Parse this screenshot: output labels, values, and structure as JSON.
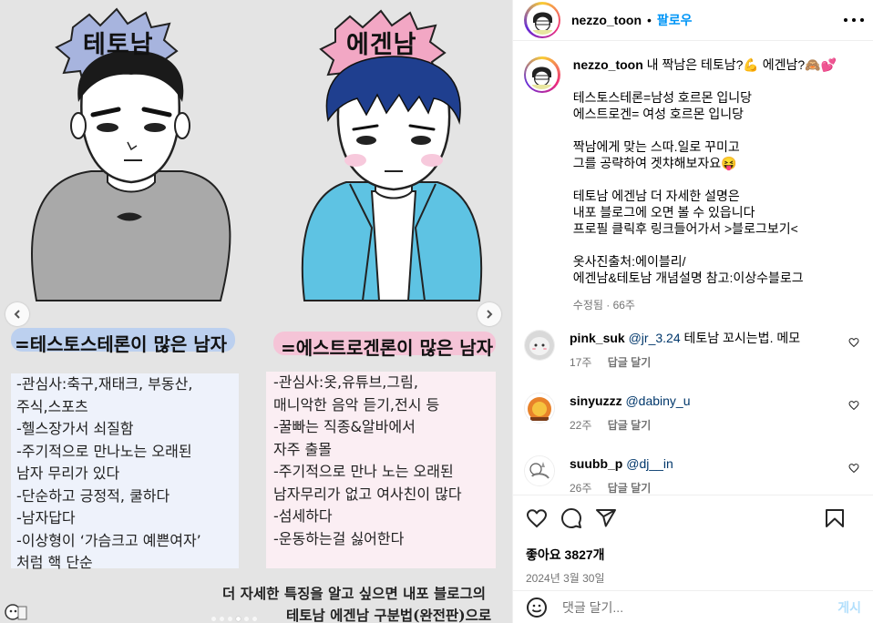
{
  "post_image": {
    "left_title": "테토남",
    "right_title": "에겐남",
    "left_caption": "=테스토스테론이 많은 남자",
    "right_caption": "=에스트로겐론이 많은 남자",
    "left_traits": [
      "-관심사:축구,재태크, 부동산,",
      "주식,스포츠",
      "-헬스장가서 쇠질함",
      "-주기적으로 만나노는 오래된",
      "남자 무리가 있다",
      "-단순하고 긍정적, 쿨하다",
      "-남자답다",
      "-이상형이 ‘가슴크고 예쁜여자’",
      "처럼 핵 단순"
    ],
    "right_traits": [
      "-관심사:옷,유튜브,그림,",
      "매니악한 음악 듣기,전시 등",
      "-꿀빠는 직종&알바에서",
      "자주 출몰",
      "-주기적으로 만나 노는 오래된",
      "남자무리가 없고 여사친이 많다",
      "-섬세하다",
      "-운동하는걸 싫어한다"
    ],
    "bottom_note_line1": "더 자세한 특징을 알고 싶으면 내포 블로그의",
    "bottom_note_line2": "테토남 에겐남 구분법(완전판)으로",
    "carousel_dots": 6,
    "carousel_active_index": 3
  },
  "header": {
    "username": "nezzo_toon",
    "separator": "•",
    "follow_label": "팔로우"
  },
  "caption": {
    "username": "nezzo_toon",
    "first_line": "내 짝남은 테토남?💪 에겐남?🙈💕",
    "para1": [
      "테스토스테론=남성 호르몬 입니당",
      "에스트로겐= 여성 호르몬 입니당"
    ],
    "para2": [
      "짝남에게 맞는 스따.일로 꾸미고",
      "그를 공략하여 겟챠해보자요😝"
    ],
    "para3": [
      "테토남 에겐남 더 자세한 설명은",
      "내포 블로그에 오면 볼 수 있읍니다",
      "프로필 클릭후 링크들어가서 >블로그보기<"
    ],
    "para4": [
      "옷사진출처:에이블리/",
      "에겐남&테토남 개념설명 참고:이상수블로그"
    ],
    "meta": "수정됨 · 66주"
  },
  "comments": [
    {
      "username": "pink_suk",
      "mention": "@jr_3.24",
      "text": " 테토남 꼬시는법. 메모",
      "time": "17주",
      "reply_label": "답글 달기"
    },
    {
      "username": "sinyuzzz",
      "mention": "@dabiny_u",
      "text": "",
      "time": "22주",
      "reply_label": "답글 달기"
    },
    {
      "username": "suubb_p",
      "mention": "@dj__in",
      "text": "",
      "time": "26주",
      "reply_label": "답글 달기"
    }
  ],
  "actions": {
    "likes": "좋아요 3827개",
    "date": "2024년 3월 30일"
  },
  "add_comment": {
    "placeholder": "댓글 달기...",
    "post_label": "게시"
  },
  "colors": {
    "accent": "#0095f6",
    "post_disabled": "#b2dffc",
    "secondary_text": "#737373",
    "mention": "#00376b",
    "image_bg": "#e4e4e4"
  },
  "icons": [
    "chevron-left-icon",
    "chevron-right-icon",
    "more-horizontal-icon",
    "heart-icon",
    "comment-icon",
    "share-icon",
    "bookmark-icon",
    "emoji-icon"
  ]
}
